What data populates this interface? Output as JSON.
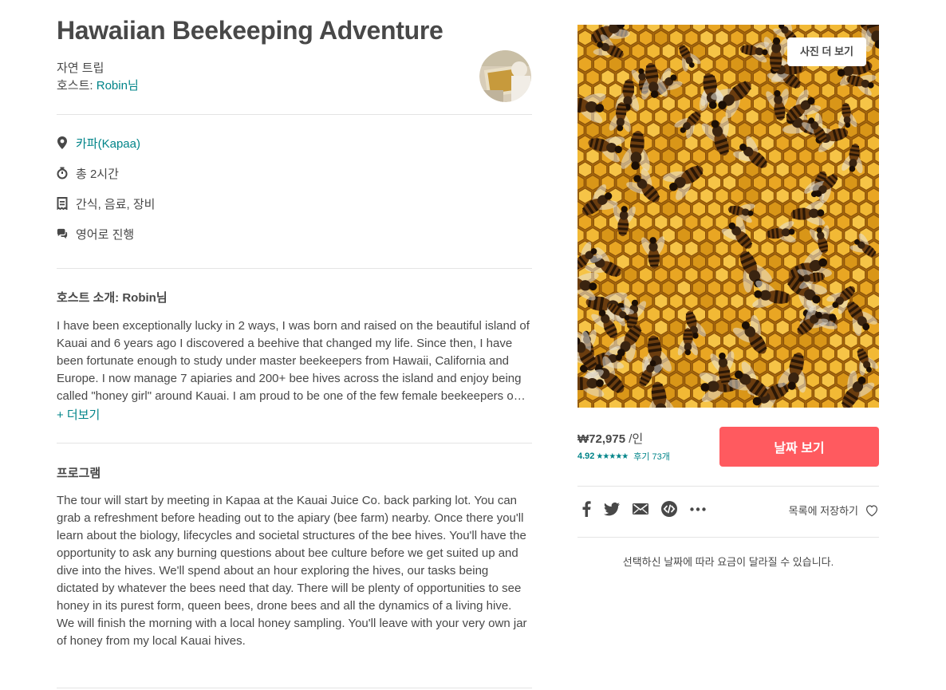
{
  "listing": {
    "title": "Hawaiian Beekeeping Adventure",
    "category": "자연 트립",
    "host_prefix": "호스트: ",
    "host_name": "Robin님"
  },
  "facts": [
    {
      "icon": "location-pin-icon",
      "text": "카파(Kapaa)"
    },
    {
      "icon": "clock-icon",
      "text": "총 2시간"
    },
    {
      "icon": "receipt-icon",
      "text": "간식, 음료, 장비"
    },
    {
      "icon": "chat-bubbles-icon",
      "text": "영어로 진행"
    }
  ],
  "host_section": {
    "title": "호스트 소개: Robin님",
    "body": "I have been exceptionally lucky in 2 ways, I was born and raised on the beautiful island of Kauai and 6 years ago I discovered a beehive that changed my life. Since then, I have been fortunate enough to study under master beekeepers from Hawaii, California and Europe. I now manage 7 apiaries and 200+ bee hives across the island and enjoy being called \"honey girl\" around Kauai. I am proud to be one of the few female beekeepers on the island.",
    "more_label": "+ 더보기"
  },
  "program": {
    "title": "프로그램",
    "body": "The tour will start by meeting in Kapaa at the Kauai Juice Co. back parking lot. You can grab a refreshment before heading out to the apiary (bee farm) nearby. Once there you'll learn about the biology, lifecycles and societal structures of the bee hives. You'll have the opportunity to ask any burning questions about bee culture before we get suited up and dive into the hives. We'll spend about an hour exploring the hives, our tasks being dictated by whatever the bees need that day. There will be plenty of opportunities to see honey in its purest form, queen bees, drone bees and all the dynamics of a living hive. We will finish the morning with a local honey sampling. You'll leave with your very own jar of honey from my local Kauai hives."
  },
  "photo": {
    "more_photos_label": "사진 더 보기"
  },
  "booking": {
    "price": "₩72,975",
    "per_person": " /인",
    "rating": "4.92",
    "stars": "★★★★★",
    "reviews": "후기 73개",
    "cta_label": "날짜 보기"
  },
  "share_icons": [
    "facebook-icon",
    "twitter-icon",
    "email-icon",
    "embed-icon",
    "more-icon"
  ],
  "save": {
    "label": "목록에 저장하기",
    "icon": "heart-icon"
  },
  "note": "선택하신 날짜에 따라 요금이 달라질 수 있습니다.",
  "colors": {
    "accent": "#008489",
    "cta": "#ff5a5f",
    "text": "#484848",
    "divider": "#e4e4e4"
  }
}
